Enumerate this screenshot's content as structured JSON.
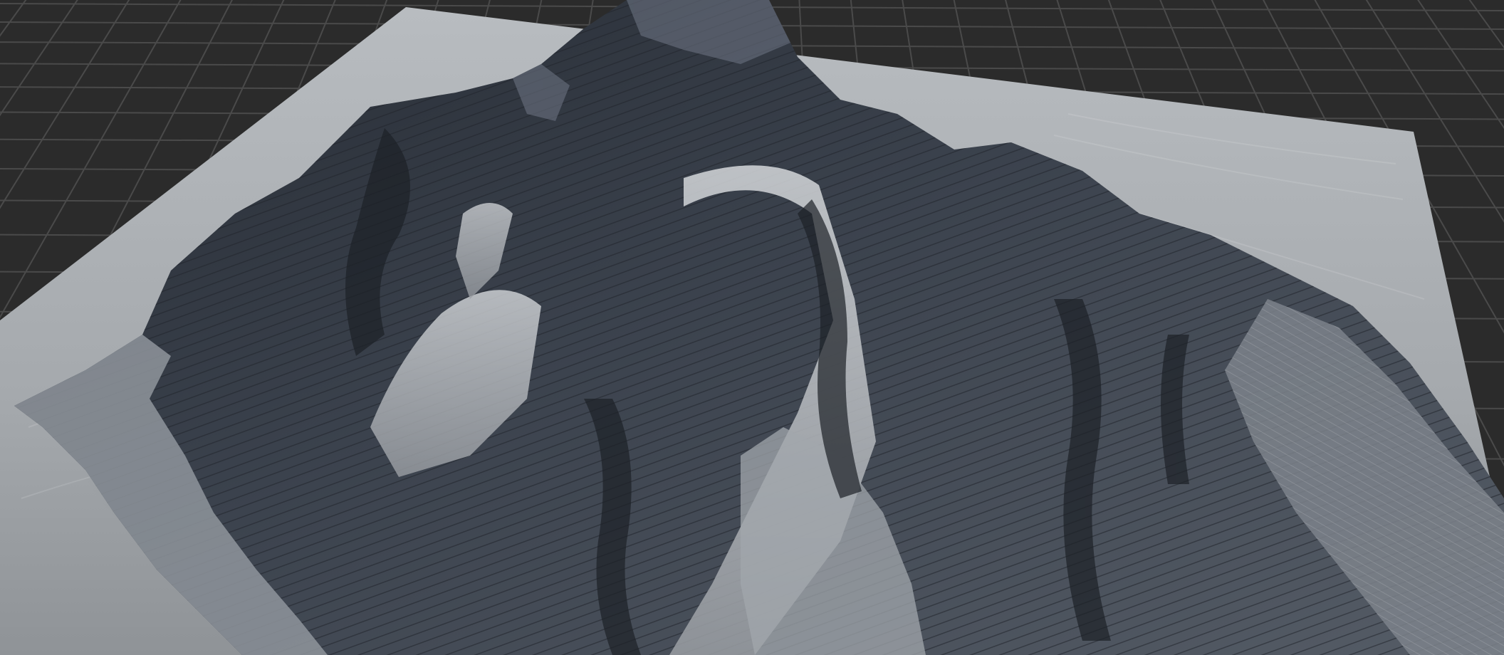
{
  "viewport": {
    "background_color": "#2b2b2b",
    "grid_line_color": "#4a4a4a",
    "terrain_plane_color": "#a9adb1",
    "terrain_dark_color": "#2c313a",
    "terrain_mid_color": "#4a515c",
    "terrain_light_color": "#c9cdd1"
  }
}
